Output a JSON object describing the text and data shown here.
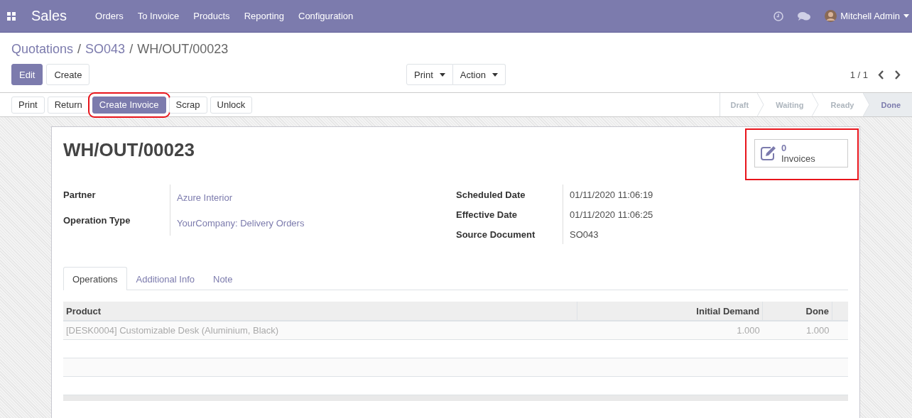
{
  "navbar": {
    "app": "Sales",
    "menu": [
      "Orders",
      "To Invoice",
      "Products",
      "Reporting",
      "Configuration"
    ],
    "user": "Mitchell Admin"
  },
  "breadcrumbs": [
    {
      "kind": "link",
      "label": "Quotations"
    },
    {
      "kind": "separator",
      "label": "/"
    },
    {
      "kind": "link",
      "label": "SO043"
    },
    {
      "kind": "separator",
      "label": "/"
    },
    {
      "kind": "current",
      "label": "WH/OUT/00023"
    }
  ],
  "buttons": [
    {
      "label": "Edit",
      "primary": true
    },
    {
      "label": "Create",
      "primary": false
    }
  ],
  "dropdowns": [
    "Print",
    "Action"
  ],
  "pager": "1 / 1",
  "actions": [
    {
      "label": "Print",
      "primary": false,
      "highlighted": false
    },
    {
      "label": "Return",
      "primary": false,
      "highlighted": false
    },
    {
      "label": "Create Invoice",
      "primary": true,
      "highlighted": true
    },
    {
      "label": "Scrap",
      "primary": false,
      "highlighted": false
    },
    {
      "label": "Unlock",
      "primary": false,
      "highlighted": false
    }
  ],
  "stages": [
    {
      "label": "Draft",
      "selected": false
    },
    {
      "label": "Waiting",
      "selected": false
    },
    {
      "label": "Ready",
      "selected": false
    },
    {
      "label": "Done",
      "selected": true
    }
  ],
  "title": "WH/OUT/00023",
  "smart_button": {
    "count": "0",
    "label": "Invoices",
    "highlighted": true
  },
  "left_fields": [
    {
      "label": "Partner",
      "value": "Azure Interior",
      "link": true
    },
    {
      "label": "Operation Type",
      "value": "YourCompany: Delivery Orders",
      "link": true
    }
  ],
  "right_fields": [
    {
      "label": "Scheduled Date",
      "value": "01/11/2020 11:06:19",
      "link": false
    },
    {
      "label": "Effective Date",
      "value": "01/11/2020 11:06:25",
      "link": false
    },
    {
      "label": "Source Document",
      "value": "SO043",
      "link": false
    }
  ],
  "tabs": [
    {
      "label": "Operations",
      "selected": true
    },
    {
      "label": "Additional Info",
      "selected": false
    },
    {
      "label": "Note",
      "selected": false
    }
  ],
  "table": {
    "columns": [
      "Product",
      "Initial Demand",
      "Done"
    ],
    "rows": [
      {
        "cells": [
          "[DESK0004] Customizable Desk (Aluminium, Black)",
          "1.000",
          "1.000"
        ],
        "readonly": true
      }
    ]
  }
}
